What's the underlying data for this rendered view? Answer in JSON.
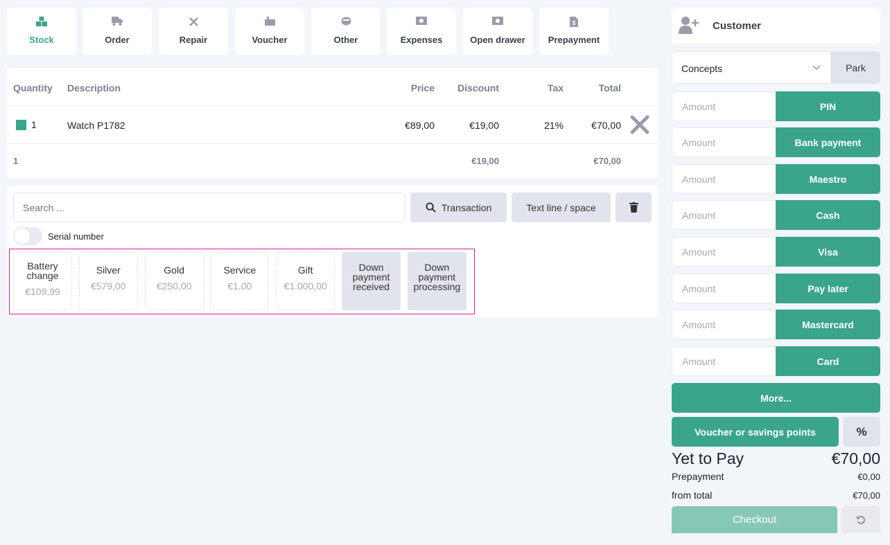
{
  "toolbar": [
    {
      "label": "Stock",
      "icon": "boxes-icon"
    },
    {
      "label": "Order",
      "icon": "truck-icon"
    },
    {
      "label": "Repair",
      "icon": "tools-icon"
    },
    {
      "label": "Voucher",
      "icon": "gift-icon"
    },
    {
      "label": "Other",
      "icon": "ring-icon"
    },
    {
      "label": "Expenses",
      "icon": "money-icon"
    },
    {
      "label": "Open drawer",
      "icon": "money-icon"
    },
    {
      "label": "Prepayment",
      "icon": "invoice-icon"
    }
  ],
  "table": {
    "headers": {
      "quantity": "Quantity",
      "description": "Description",
      "price": "Price",
      "discount": "Discount",
      "tax": "Tax",
      "total": "Total"
    },
    "rows": [
      {
        "quantity": "1",
        "description": "Watch P1782",
        "price": "€89,00",
        "discount": "€19,00",
        "tax": "21%",
        "total": "€70,00"
      }
    ],
    "footer": {
      "quantity": "1",
      "discount": "€19,00",
      "total": "€70,00"
    }
  },
  "search": {
    "placeholder": "Search ...",
    "transaction": "Transaction",
    "text_line": "Text line / space",
    "serial_number": "Serial number"
  },
  "quick_items": [
    {
      "name": "Battery change",
      "price": "€109,99"
    },
    {
      "name": "Silver",
      "price": "€579,00"
    },
    {
      "name": "Gold",
      "price": "€250,00"
    },
    {
      "name": "Service",
      "price": "€1,00"
    },
    {
      "name": "Gift",
      "price": "€1.000,00"
    },
    {
      "name": "Down payment received",
      "price": null
    },
    {
      "name": "Down payment processing",
      "price": null
    }
  ],
  "sidebar": {
    "customer": "Customer",
    "concepts": "Concepts",
    "park": "Park",
    "amount_placeholder": "Amount",
    "payments": [
      "PIN",
      "Bank payment",
      "Maestro",
      "Cash",
      "Visa",
      "Pay later",
      "Mastercard",
      "Card"
    ],
    "more": "More...",
    "voucher": "Voucher or savings points",
    "percent": "%",
    "yet_to_pay_label": "Yet to Pay",
    "yet_to_pay": "€70,00",
    "prepayment_label": "Prepayment",
    "prepayment": "€0,00",
    "from_total_label": "from total",
    "from_total": "€70,00",
    "checkout": "Checkout"
  },
  "colors": {
    "accent": "#3aa58a",
    "highlight": "#d61f8f"
  }
}
